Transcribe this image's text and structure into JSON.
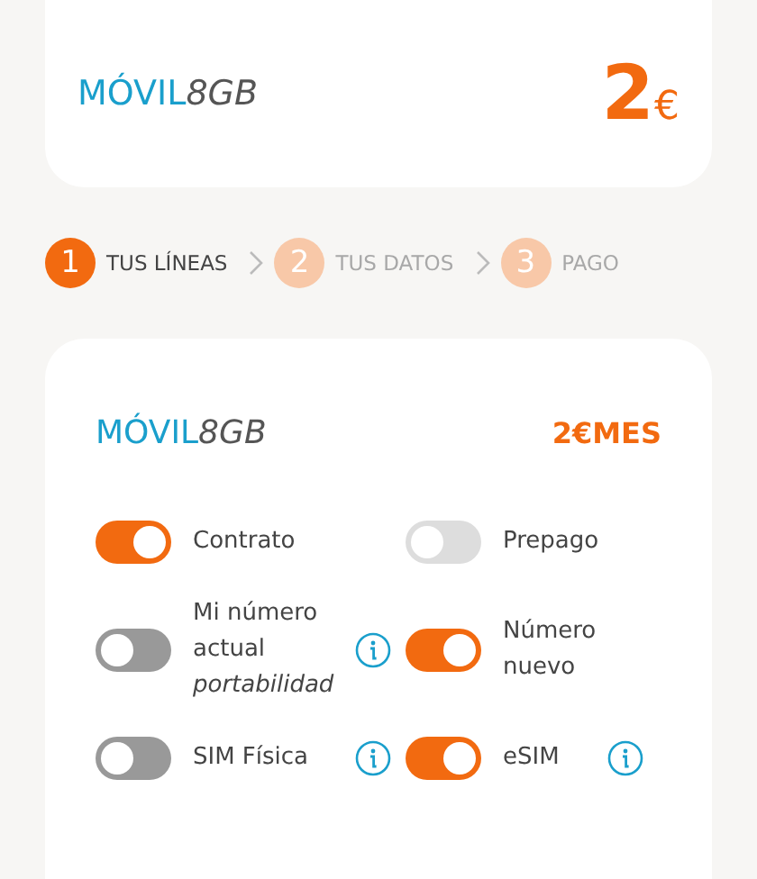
{
  "summary": {
    "brand": "MÓVIL",
    "data": "8GB",
    "price": "2",
    "currency": "€"
  },
  "steps": [
    {
      "number": "1",
      "label": "TUS LÍNEAS",
      "selected": true
    },
    {
      "number": "2",
      "label": "TUS DATOS",
      "selected": false
    },
    {
      "number": "3",
      "label": "PAGO",
      "selected": false
    }
  ],
  "line": {
    "brand": "MÓVIL",
    "data": "8GB",
    "price": "2€MES",
    "options": [
      {
        "label": "Contrato",
        "on": true,
        "disabled": false,
        "info": false
      },
      {
        "label": "Prepago",
        "on": false,
        "disabled": true,
        "info": false
      },
      {
        "label": "Mi número actual",
        "note": "portabilidad",
        "on": false,
        "disabled": false,
        "info": true
      },
      {
        "label": "Número nuevo",
        "on": true,
        "disabled": false,
        "info": false
      },
      {
        "label": "SIM Física",
        "on": false,
        "disabled": false,
        "info": true
      },
      {
        "label": "eSIM",
        "on": true,
        "disabled": false,
        "info": true
      }
    ]
  }
}
